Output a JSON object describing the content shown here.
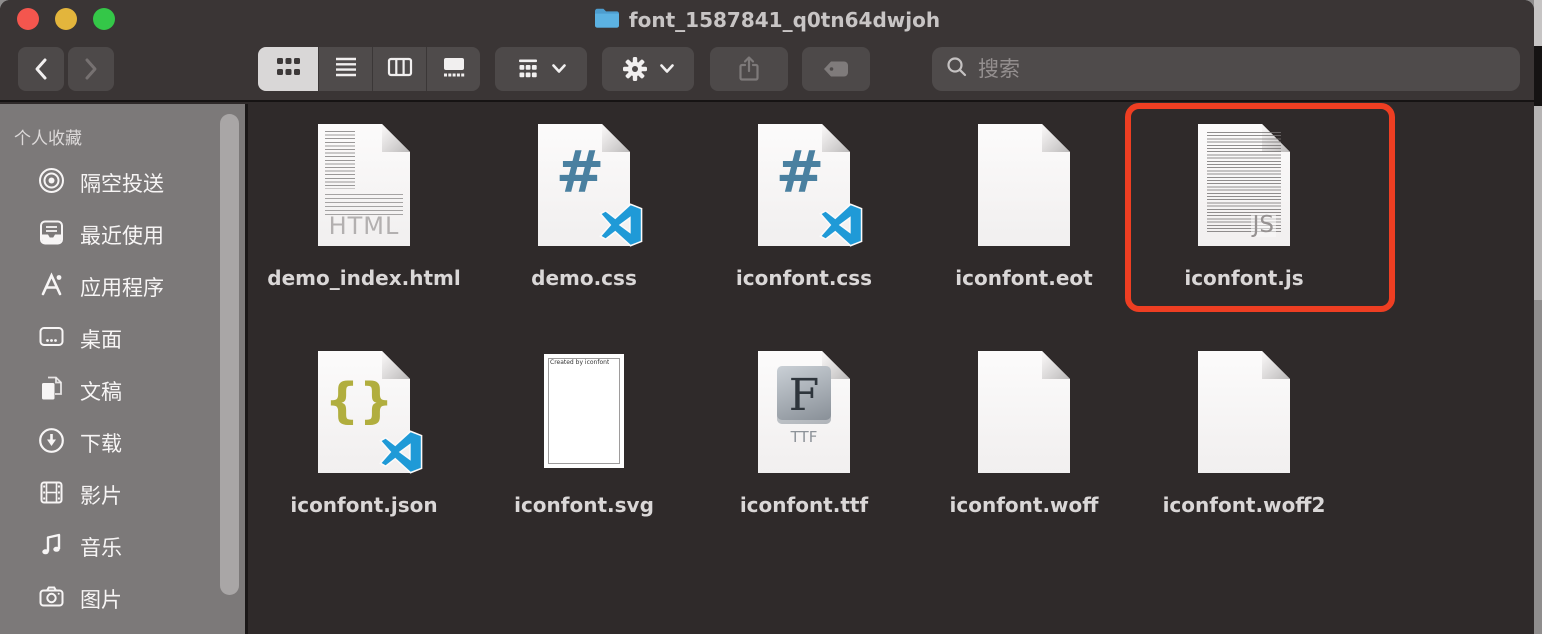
{
  "window": {
    "title": "font_1587841_q0tn64dwjoh"
  },
  "toolbar": {
    "view_modes": [
      "icons",
      "list",
      "columns",
      "gallery"
    ],
    "active_view": "icons",
    "search_placeholder": "搜索"
  },
  "sidebar": {
    "header": "个人收藏",
    "items": [
      {
        "label": "隔空投送",
        "icon": "airdrop-icon"
      },
      {
        "label": "最近使用",
        "icon": "recents-icon"
      },
      {
        "label": "应用程序",
        "icon": "applications-icon"
      },
      {
        "label": "桌面",
        "icon": "desktop-icon"
      },
      {
        "label": "文稿",
        "icon": "documents-icon"
      },
      {
        "label": "下载",
        "icon": "downloads-icon"
      },
      {
        "label": "影片",
        "icon": "movies-icon"
      },
      {
        "label": "音乐",
        "icon": "music-icon"
      },
      {
        "label": "图片",
        "icon": "pictures-icon"
      }
    ]
  },
  "files": [
    {
      "name": "demo_index.html",
      "type": "html-document",
      "badge_text": "HTML"
    },
    {
      "name": "demo.css",
      "type": "css-code-document",
      "badge_text": "#"
    },
    {
      "name": "iconfont.css",
      "type": "css-code-document",
      "badge_text": "#"
    },
    {
      "name": "iconfont.eot",
      "type": "generic-document"
    },
    {
      "name": "iconfont.js",
      "type": "js-document",
      "badge_text": "JS",
      "annotated": true
    },
    {
      "name": "iconfont.json",
      "type": "json-code-document",
      "badge_text": "{}"
    },
    {
      "name": "iconfont.svg",
      "type": "svg-preview-document",
      "note_text": "Created by iconfont"
    },
    {
      "name": "iconfont.ttf",
      "type": "ttf-font-document",
      "badge_text": "F",
      "sub_text": "TTF"
    },
    {
      "name": "iconfont.woff",
      "type": "generic-document"
    },
    {
      "name": "iconfont.woff2",
      "type": "generic-document"
    }
  ],
  "annotation": {
    "target": "iconfont.js",
    "color": "#ee3e22"
  },
  "colors": {
    "titlebar_bg": "#3a3535",
    "content_bg": "#2f2a2a",
    "sidebar_bg": "#7c7979",
    "folder_blue": "#58aede",
    "vscode_blue": "#1f9ad7",
    "hash_blue": "#4a80a0",
    "json_olive": "#b1ae3e",
    "annotation_red": "#ee3e22",
    "traffic_red": "#f4564e",
    "traffic_yellow": "#e3b53c",
    "traffic_green": "#34c748"
  }
}
